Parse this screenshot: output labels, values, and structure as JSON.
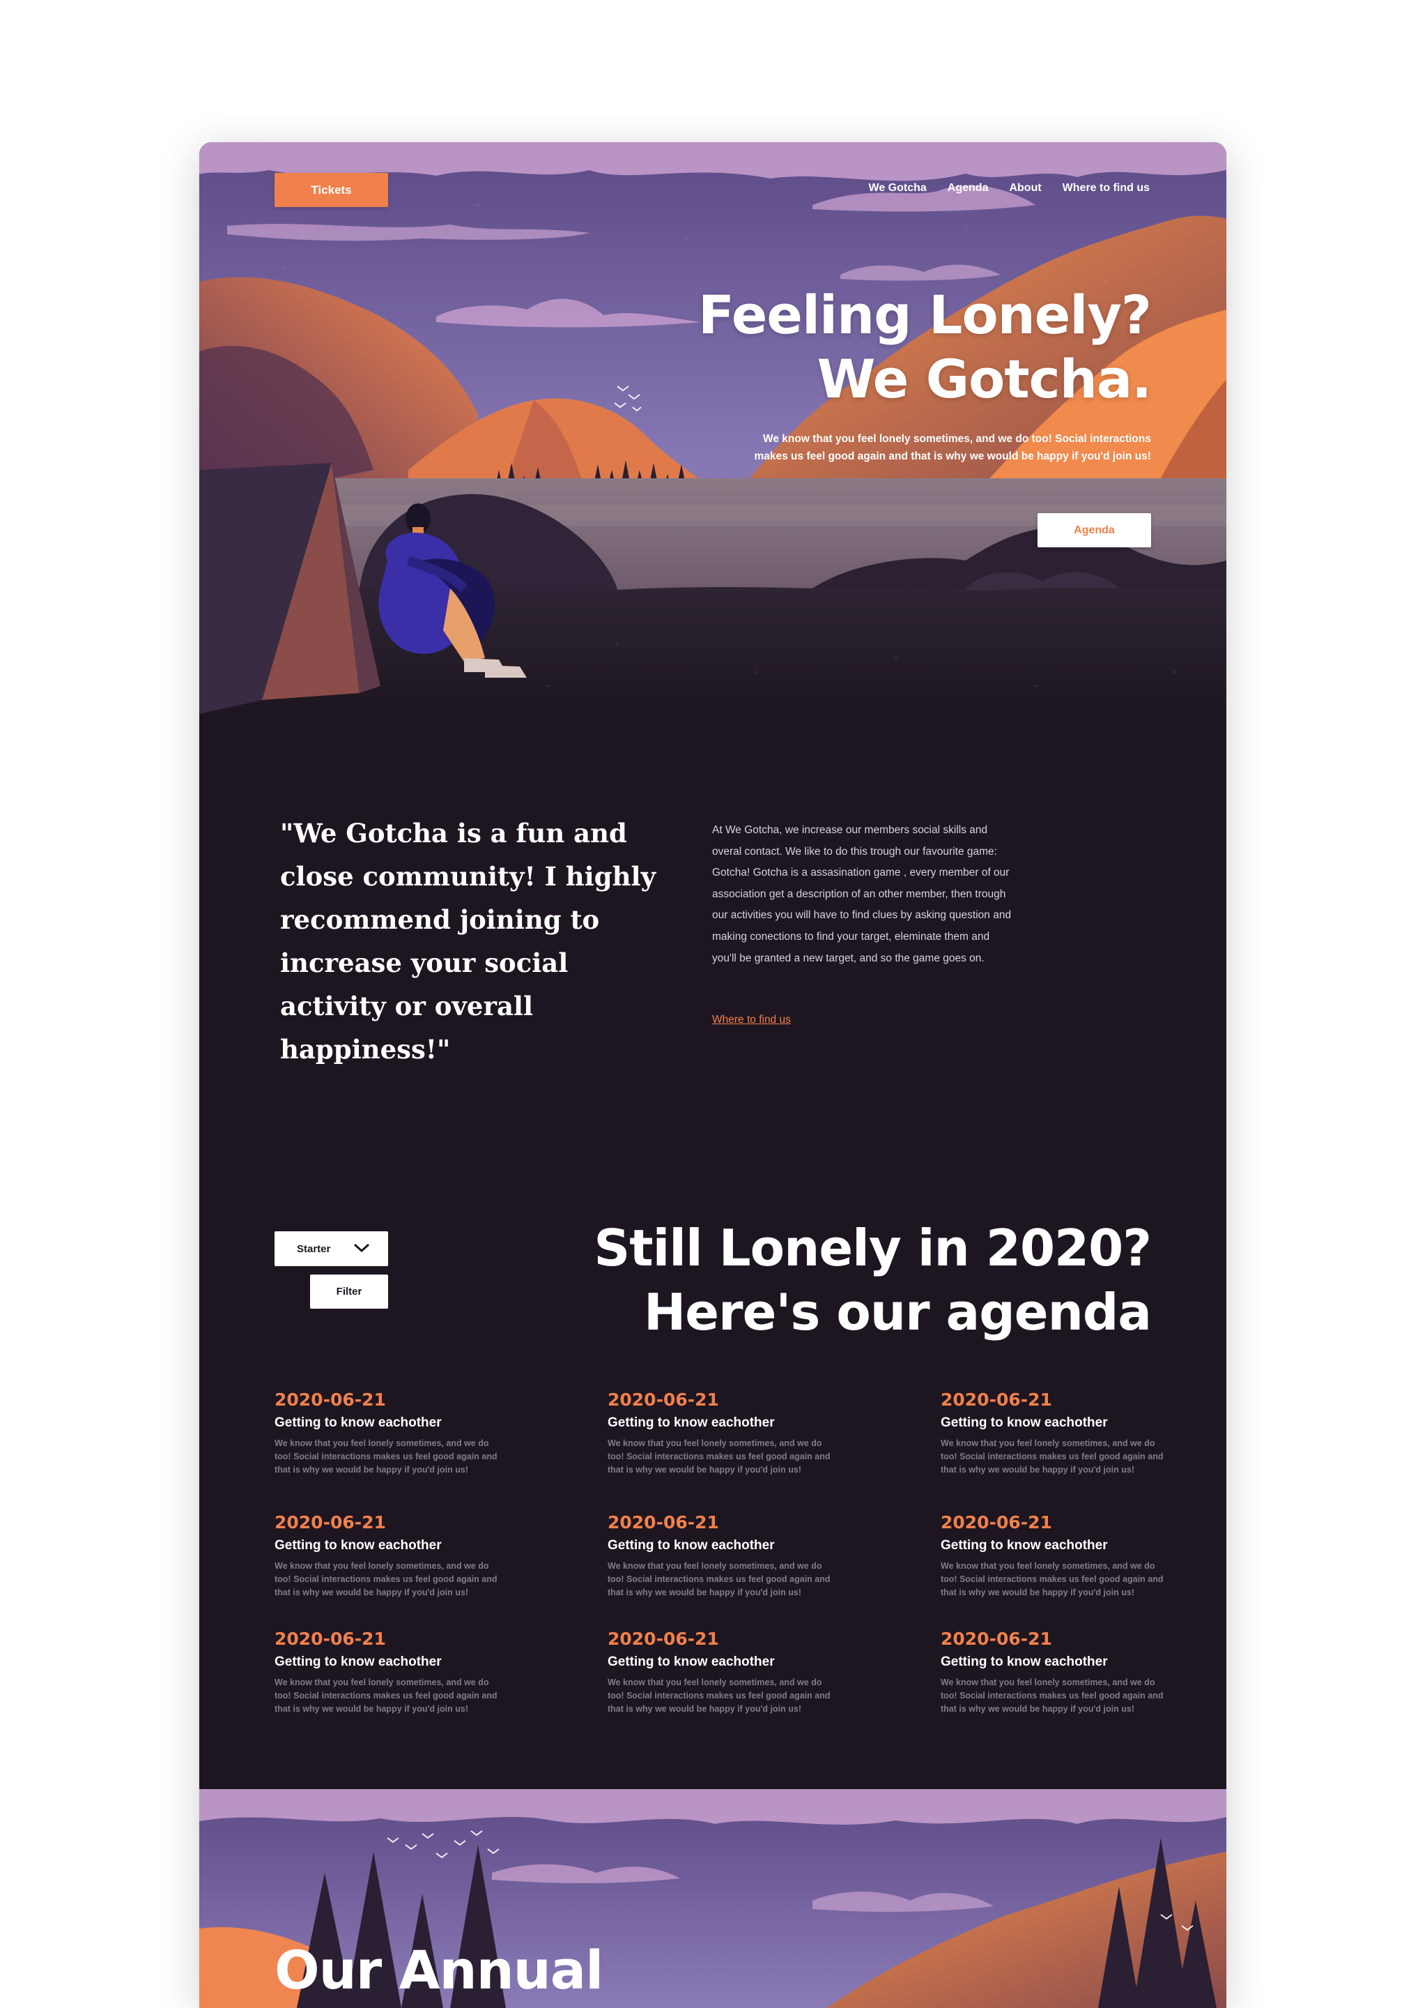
{
  "header": {
    "tickets_label": "Tickets",
    "nav": [
      "We Gotcha",
      "Agenda",
      "About",
      "Where to find us"
    ]
  },
  "hero": {
    "title_line1": "Feeling Lonely?",
    "title_line2": "We Gotcha.",
    "subtitle": "We know that you feel lonely sometimes, and we do too! Social interactions makes us feel good again and that is why we would be happy if you'd join us!",
    "agenda_button": "Agenda"
  },
  "about": {
    "quote": "\"We Gotcha is a fun and close community! I highly recommend joining to increase your social activity or overall happiness!\"",
    "text": "At We Gotcha, we increase our members social skills and overal contact. We like to do this trough  our favourite game: Gotcha! Gotcha is a assasination game , every member of our association get a description of an other member, then trough our activities you will have to find clues by asking question and making conections to find your target, eleminate them and you'll be granted a new target, and so the game goes on.",
    "link": "Where to find us"
  },
  "agenda": {
    "select_value": "Starter",
    "filter_label": "Filter",
    "title_line1": "Still Lonely in 2020?",
    "title_line2": "Here's our agenda",
    "events": [
      {
        "date": "2020-06-21",
        "title": "Getting to know eachother",
        "desc": "We know that you feel lonely sometimes, and we do too! Social interactions makes us feel good again and that is why we would be happy if you'd join us!"
      },
      {
        "date": "2020-06-21",
        "title": "Getting to know eachother",
        "desc": "We know that you feel lonely sometimes, and we do too! Social interactions makes us feel good again and that is why we would be happy if you'd join us!"
      },
      {
        "date": "2020-06-21",
        "title": "Getting to know eachother",
        "desc": "We know that you feel lonely sometimes, and we do too! Social interactions makes us feel good again and that is why we would be happy if you'd join us!"
      },
      {
        "date": "2020-06-21",
        "title": "Getting to know eachother",
        "desc": "We know that you feel lonely sometimes, and we do too! Social interactions makes us feel good again and that is why we would be happy if you'd join us!"
      },
      {
        "date": "2020-06-21",
        "title": "Getting to know eachother",
        "desc": "We know that you feel lonely sometimes, and we do too! Social interactions makes us feel good again and that is why we would be happy if you'd join us!"
      },
      {
        "date": "2020-06-21",
        "title": "Getting to know eachother",
        "desc": "We know that you feel lonely sometimes, and we do too! Social interactions makes us feel good again and that is why we would be happy if you'd join us!"
      },
      {
        "date": "2020-06-21",
        "title": "Getting to know eachother",
        "desc": "We know that you feel lonely sometimes, and we do too! Social interactions makes us feel good again and that is why we would be happy if you'd join us!"
      },
      {
        "date": "2020-06-21",
        "title": "Getting to know eachother",
        "desc": "We know that you feel lonely sometimes, and we do too! Social interactions makes us feel good again and that is why we would be happy if you'd join us!"
      },
      {
        "date": "2020-06-21",
        "title": "Getting to know eachother",
        "desc": "We know that you feel lonely sometimes, and we do too! Social interactions makes us feel good again and that is why we would be happy if you'd join us!"
      }
    ]
  },
  "banner": {
    "title": "Our Annual"
  },
  "colors": {
    "accent": "#f0804c",
    "background": "#1d1620",
    "sky": "#8a73b0",
    "cloud": "#c39ccb"
  }
}
